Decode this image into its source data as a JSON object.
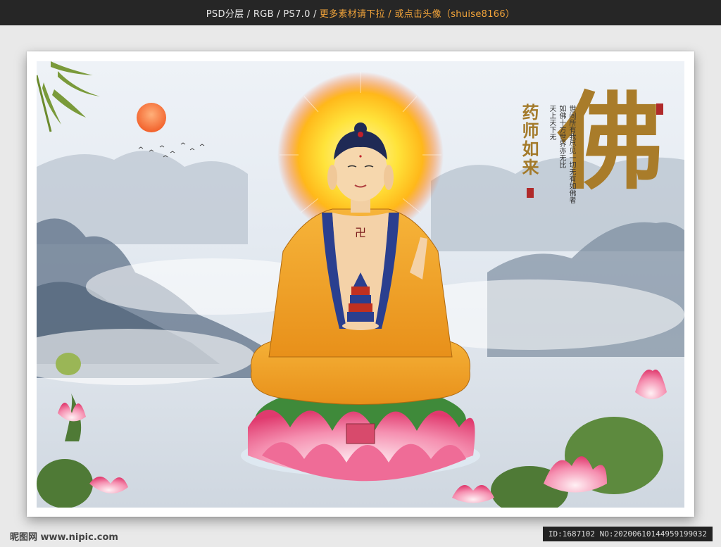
{
  "topbar": {
    "prefix": "PSD分层 / RGB / PS7.0 /",
    "highlight": "更多素材请下拉 / 或点击头像（shuise8166）"
  },
  "artwork": {
    "big_character": "佛",
    "title_vertical": "药师如来",
    "poem_columns": [
      "天上天下无",
      "如佛十方世界亦无比",
      "世间所有我尽见一切无有如佛者"
    ],
    "chest_symbol": "卍",
    "accent_gold": "#a97c2a",
    "robe_color": "#f0a020",
    "lotus_pink": "#f06a93"
  },
  "footer": {
    "watermark": "昵图网 www.nipic.com",
    "id_text": "ID:1687102 NO:20200610144959199032"
  }
}
